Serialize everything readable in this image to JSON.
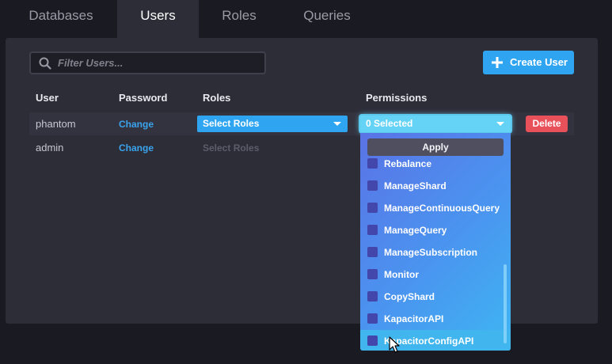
{
  "tabs": [
    {
      "label": "Databases",
      "active": false
    },
    {
      "label": "Users",
      "active": true
    },
    {
      "label": "Roles",
      "active": false
    },
    {
      "label": "Queries",
      "active": false
    }
  ],
  "toolbar": {
    "search_placeholder": "Filter Users...",
    "create_label": "Create User"
  },
  "table": {
    "headers": [
      "User",
      "Password",
      "Roles",
      "Permissions"
    ],
    "rows": [
      {
        "user": "phantom",
        "password_link": "Change",
        "roles": "Select Roles",
        "permissions": "0 Selected",
        "delete": "Delete"
      },
      {
        "user": "admin",
        "password_link": "Change",
        "roles": "Select Roles"
      }
    ]
  },
  "permissions_menu": {
    "apply_label": "Apply",
    "items": [
      "Rebalance",
      "ManageShard",
      "ManageContinuousQuery",
      "ManageQuery",
      "ManageSubscription",
      "Monitor",
      "CopyShard",
      "KapacitorAPI",
      "KapacitorConfigAPI"
    ],
    "hovered_item": "KapacitorConfigAPI"
  },
  "colors": {
    "accent": "#2fa5f2",
    "danger": "#e8505a",
    "panel": "#2d2d38",
    "background": "#1a1a22"
  },
  "icons": {
    "search": "search-icon",
    "plus": "plus-icon",
    "caret": "caret-down-icon",
    "cursor": "mouse-pointer-icon"
  }
}
